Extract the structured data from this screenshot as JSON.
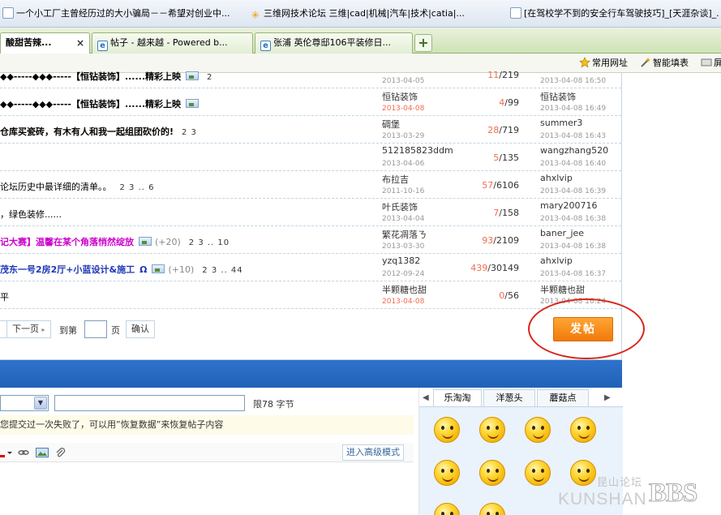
{
  "favorites": [
    {
      "icon": "page-icon",
      "label": "一个小工厂主曾经历过的大小骗局－－希望对创业中..."
    },
    {
      "icon": "star-icon",
      "label": "三维网技术论坛 三维|cad|机械|汽车|技术|catia|..."
    },
    {
      "icon": "page-icon",
      "label": "[在驾校学不到的安全行车驾驶技巧]_[天涯杂谈]_..."
    }
  ],
  "tabs": [
    {
      "label": "酸甜苦辣...",
      "close": "×",
      "active": true
    },
    {
      "label": "帖子 - 越来越 - Powered b...",
      "active": false
    },
    {
      "label": "张浦 英伦尊邸106平装修日...",
      "active": false
    }
  ],
  "new_tab": "+",
  "toolbar": {
    "common_sites": "常用网址",
    "smart_fill": "智能填表",
    "extra": "屏"
  },
  "threads": [
    {
      "title": "◆◆-----◆◆◆-----【恒钻装饰】......精彩上映",
      "has_image": true,
      "pages": "2",
      "author": "",
      "author_date": "2013-04-05",
      "hot_date": false,
      "replies": "11",
      "views": "219",
      "last_user": "",
      "last_date": "2013-04-08 16:50",
      "style": "bold"
    },
    {
      "title": "◆◆-----◆◆◆-----【恒钻装饰】......精彩上映",
      "has_image": true,
      "pages": "",
      "author": "恒钻装饰",
      "author_date": "2013-04-08",
      "hot_date": true,
      "replies": "4",
      "views": "99",
      "last_user": "恒钻装饰",
      "last_date": "2013-04-08 16:49",
      "style": "bold"
    },
    {
      "title": "仓库买瓷砖，有木有人和我一起组团砍价的!",
      "has_image": false,
      "pages": "2 3",
      "author": "碉堡",
      "author_date": "2013-03-29",
      "hot_date": false,
      "replies": "28",
      "views": "719",
      "last_user": "summer3",
      "last_date": "2013-04-08 16:43",
      "style": "bold"
    },
    {
      "title": "",
      "has_image": false,
      "pages": "",
      "author": "512185823ddm",
      "author_date": "2013-04-06",
      "hot_date": false,
      "replies": "5",
      "views": "135",
      "last_user": "wangzhang520",
      "last_date": "2013-04-08 16:40",
      "style": "normal"
    },
    {
      "title": "论坛历史中最详细的清单。。",
      "has_image": false,
      "pages": "2 3 .. 6",
      "author": "布拉吉",
      "author_date": "2011-10-16",
      "hot_date": false,
      "replies": "57",
      "views": "6106",
      "last_user": "ahxlvip",
      "last_date": "2013-04-08 16:39",
      "style": "normal"
    },
    {
      "title": "，绿色装修......",
      "has_image": false,
      "pages": "",
      "author": "叶氏装饰",
      "author_date": "2013-04-04",
      "hot_date": false,
      "replies": "7",
      "views": "158",
      "last_user": "mary200716",
      "last_date": "2013-04-08 16:38",
      "style": "normal"
    },
    {
      "title": "记大赛】温馨在某个角落悄然绽放",
      "has_image": true,
      "score": "(+20)",
      "pages": "2 3 .. 10",
      "author": "繁花凋落ㄋ",
      "author_date": "2013-03-30",
      "hot_date": false,
      "replies": "93",
      "views": "2109",
      "last_user": "baner_jee",
      "last_date": "2013-04-08 16:38",
      "style": "magenta"
    },
    {
      "title": "茂东一号2房2厅+小蓝设计&施工",
      "omega": "Ω",
      "has_image": true,
      "score": "(+10)",
      "pages": "2 3 .. 44",
      "author": "yzq1382",
      "author_date": "2012-09-24",
      "hot_date": false,
      "replies": "439",
      "views": "30149",
      "last_user": "ahxlvip",
      "last_date": "2013-04-08 16:37",
      "style": "blue"
    },
    {
      "title": "平",
      "has_image": false,
      "pages": "",
      "author": "半颗糖也甜",
      "author_date": "2013-04-08",
      "hot_date": true,
      "replies": "0",
      "views": "56",
      "last_user": "半颗糖也甜",
      "last_date": "2013-04-08 16:24",
      "style": "normal"
    }
  ],
  "pagination": {
    "next": "下一页",
    "goto": "到第",
    "page": "页",
    "confirm": "确认"
  },
  "post_button": "发帖",
  "reply": {
    "char_limit": "限78 字节",
    "restore_msg": "您提交过一次失败了，可以用”恢复数据”来恢复帖子内容",
    "advanced_mode": "进入高级模式"
  },
  "smiley_tabs": [
    "乐淘淘",
    "洋葱头",
    "蘑菇点"
  ],
  "smiley_nav": {
    "prev": "◀",
    "next": "▶"
  },
  "watermark": {
    "cn": "昆山论坛",
    "en": "KUNSHAN",
    "bbs": "BBS"
  },
  "colors": {
    "accent_blue": "#2f73cc",
    "post_orange": "#f07a0a",
    "hot_red": "#f26c4f",
    "ellipse_red": "#d9261c"
  }
}
